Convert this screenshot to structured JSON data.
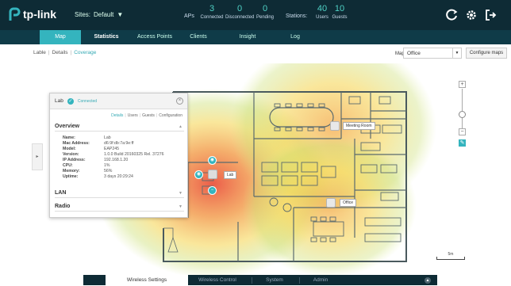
{
  "brand": {
    "name": "tp-link"
  },
  "header": {
    "sites_label": "Sites:",
    "site_value": "Default",
    "aps_label": "APs",
    "aps": [
      {
        "value": "3",
        "label": "Connected"
      },
      {
        "value": "0",
        "label": "Disconnected"
      },
      {
        "value": "0",
        "label": "Pending"
      }
    ],
    "stations_label": "Stations:",
    "stations": [
      {
        "value": "40",
        "label": "Users"
      },
      {
        "value": "10",
        "label": "Guests"
      }
    ],
    "icons": [
      "refresh-icon",
      "gear-icon",
      "logout-icon"
    ]
  },
  "nav": {
    "tabs": [
      "Map",
      "Statistics",
      "Access Points",
      "Clients",
      "Insight",
      "Log"
    ],
    "active": "Map"
  },
  "breadcrumb": {
    "items": [
      "Lable",
      "Details",
      "Coverage"
    ],
    "current": "Coverage"
  },
  "map_select": {
    "label": "Map:",
    "value": "Office"
  },
  "configure_label": "Configure maps",
  "panel": {
    "ap_name": "Lab",
    "status": "Connected",
    "subtabs": [
      "Details",
      "Users",
      "Guests",
      "Configuration"
    ],
    "overview_title": "Overview",
    "fields": [
      {
        "k": "Name:",
        "v": "Lab"
      },
      {
        "k": "Mac Address:",
        "v": "d6:9f:db:7a:9e:ff"
      },
      {
        "k": "Model:",
        "v": "EAP245"
      },
      {
        "k": "Version:",
        "v": "1.0.0 Build 20160325 Rel. 37276"
      },
      {
        "k": "IP Address:",
        "v": "192.168.1.20"
      },
      {
        "k": "CPU:",
        "v": "1%"
      },
      {
        "k": "Memory:",
        "v": "56%"
      },
      {
        "k": "Uptime:",
        "v": "3 days 20:29:24"
      }
    ],
    "lan_title": "LAN",
    "radio_title": "Radio"
  },
  "map": {
    "aps": [
      {
        "name": "Meeting Room"
      },
      {
        "name": "Lab"
      },
      {
        "name": "Office"
      }
    ],
    "scale": "5m"
  },
  "bottom": {
    "tabs": [
      "Wireless Settings",
      "Wireless Control",
      "System",
      "Admin"
    ],
    "active": "Wireless Settings"
  }
}
